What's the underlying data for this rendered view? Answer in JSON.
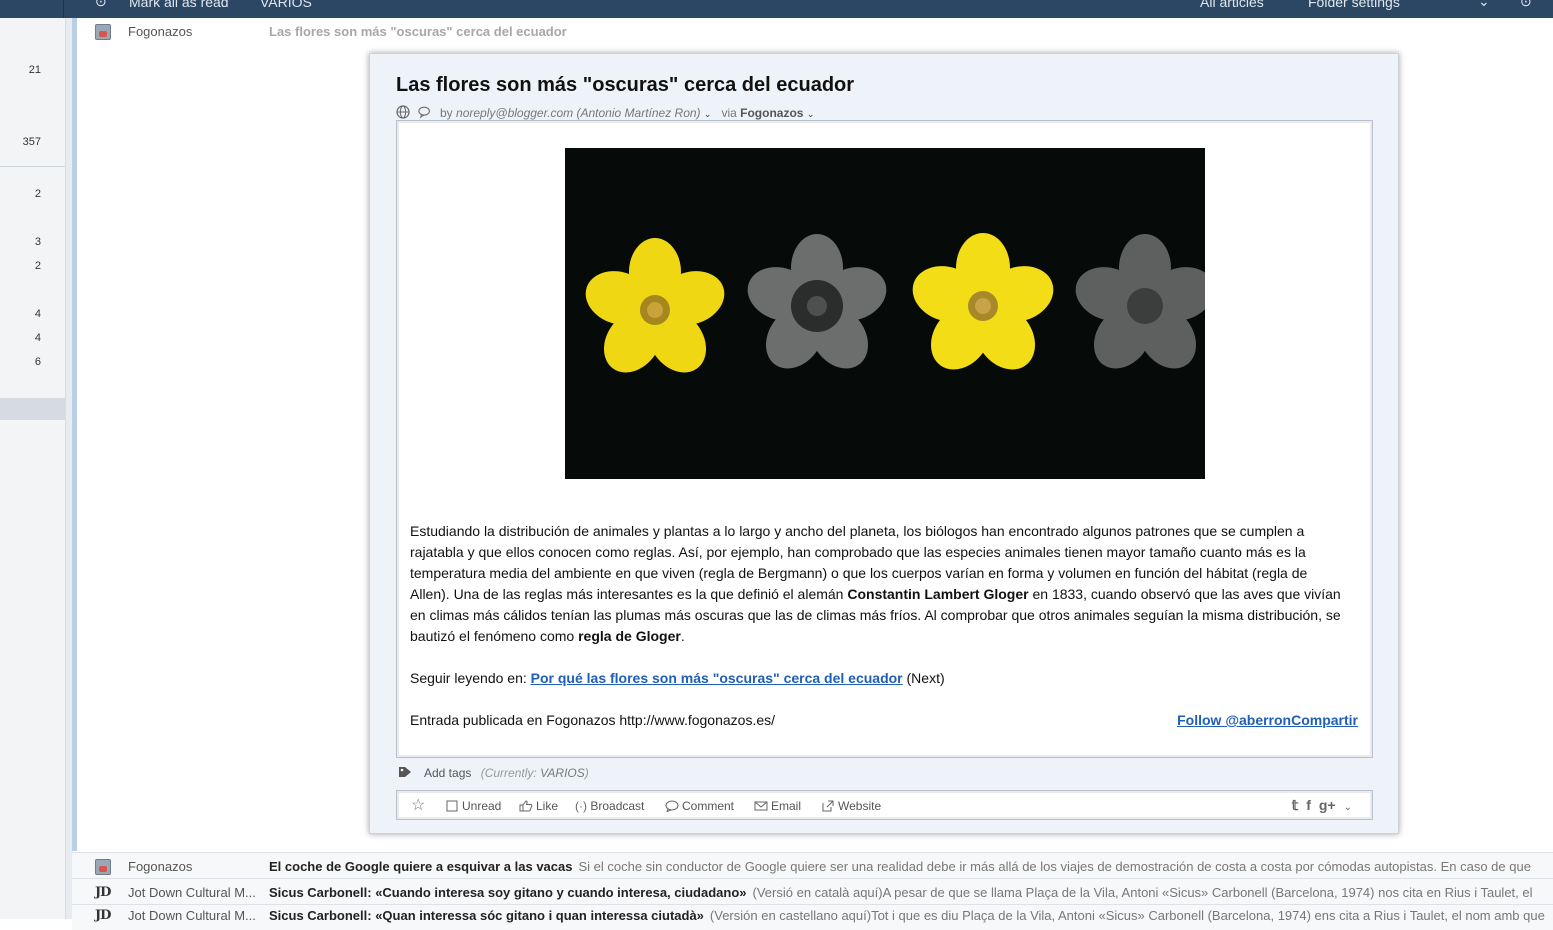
{
  "toolbar": {
    "mark_all_read": "Mark all as read",
    "folder": "VARIOS",
    "all_articles": "All articles",
    "folder_settings": "Folder settings"
  },
  "sidebar": {
    "counts": [
      "21",
      "357",
      "2",
      "3",
      "2",
      "4",
      "4",
      "6"
    ]
  },
  "expanded_row": {
    "source": "Fogonazos",
    "title": "Las flores son más \"oscuras\" cerca del ecuador"
  },
  "article": {
    "title": "Las flores son más \"oscuras\" cerca del ecuador",
    "by_prefix": "by",
    "author": "noreply@blogger.com (Antonio Martínez Ron)",
    "via_prefix": "via",
    "via_feed": "Fogonazos",
    "p1_a": "Estudiando la distribución de animales y plantas a lo largo y ancho del planeta, los biólogos han encontrado algunos patrones que se cumplen a rajatabla y que ellos conocen como reglas. Así, por ejemplo, han comprobado que las especies animales tienen mayor tamaño cuanto más es la temperatura media del ambiente en que viven (regla de Bergmann) o que los cuerpos varían en forma y volumen en función del hábitat (regla de Allen). Una de las reglas más interesantes es la que definió el alemán ",
    "p1_bold1": "Constantin Lambert Gloger",
    "p1_b": " en 1833, cuando observó que las aves que vivían en climas más cálidos tenían las plumas más oscuras que las de climas más fríos. Al comprobar que otros animales seguían la misma distribución, se bautizó el fenómeno como ",
    "p1_bold2": "regla de Gloger",
    "p1_end": ".",
    "continue_prefix": "Seguir leyendo en: ",
    "continue_link": "Por qué las flores son más \"oscuras\" cerca del ecuador",
    "continue_suffix": " (Next)",
    "published": "Entrada publicada en Fogonazos http://www.fogonazos.es/",
    "follow_link": "Follow @aberronCompartir",
    "add_tags": "Add tags",
    "currently_label": "(Currently:",
    "currently_value": "VARIOS",
    "currently_close": ")"
  },
  "actions": {
    "unread": "Unread",
    "like": "Like",
    "broadcast": "Broadcast",
    "comment": "Comment",
    "email": "Email",
    "website": "Website",
    "share_icons": [
      "twitter-icon",
      "facebook-icon",
      "google-plus-icon"
    ]
  },
  "list_rows": [
    {
      "source": "Fogonazos",
      "title": "El coche de Google quiere a esquivar a las vacas",
      "snippet": "Si el coche sin conductor de Google quiere ser una realidad debe ir más allá de los viajes de demostración de costa a costa por cómodas autopistas. En caso de que"
    },
    {
      "source": "Jot Down Cultural M...",
      "title": "Sicus Carbonell: «Cuando interesa soy gitano y cuando interesa, ciudadano»",
      "snippet": "(Versió en català aquí)A pesar de que se llama Plaça de la Vila, Antoni «Sicus» Carbonell (Barcelona, 1974) nos cita en Rius i Taulet, el"
    },
    {
      "source": "Jot Down Cultural M...",
      "title": "Sicus Carbonell: «Quan interessa sóc gitano i quan interessa ciutadà»",
      "snippet": "(Versión en castellano aquí)Tot i que es diu Plaça de la Vila, Antoni «Sicus» Carbonell (Barcelona, 1974) ens cita a Rius i Taulet, el nom amb que"
    }
  ],
  "colors": {
    "toolbar_bg": "#2b4764",
    "card_bg": "#eef3fa",
    "link": "#1f5fb6",
    "flower_yellow": "#f3dd16"
  }
}
